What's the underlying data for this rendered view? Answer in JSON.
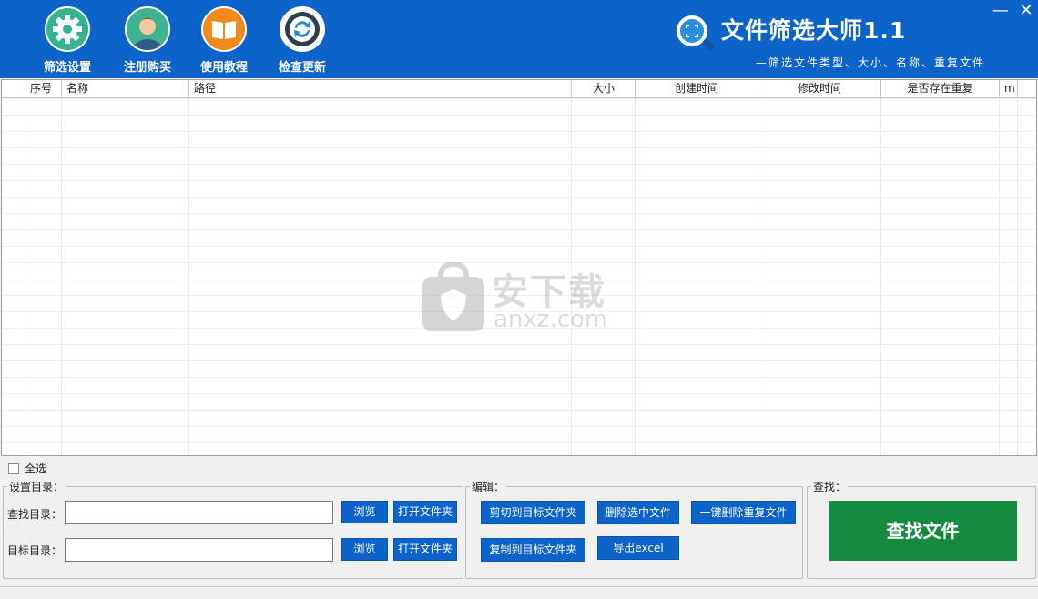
{
  "toolbar": {
    "items": [
      {
        "label": "筛选设置"
      },
      {
        "label": "注册购买"
      },
      {
        "label": "使用教程"
      },
      {
        "label": "检查更新"
      }
    ]
  },
  "brand": {
    "title": "文件筛选大师1.1",
    "subtitle": "—筛选文件类型、大小、名称、重复文件"
  },
  "window": {
    "minimize": "—",
    "close": "✕"
  },
  "table": {
    "columns": [
      "",
      "序号",
      "名称",
      "路径",
      "大小",
      "创建时间",
      "修改时间",
      "是否存在重复",
      "m"
    ]
  },
  "watermark": {
    "big": "安下载",
    "small": "anxz.com"
  },
  "select_all": {
    "label": "全选"
  },
  "settings": {
    "legend": "设置目录：",
    "search_dir_label": "查找目录：",
    "target_dir_label": "目标目录：",
    "search_dir_value": "",
    "target_dir_value": "",
    "browse1": "浏览",
    "open1": "打开文件夹",
    "browse2": "浏览",
    "open2": "打开文件夹"
  },
  "edit": {
    "legend": "编辑：",
    "cut": "剪切到目标文件夹",
    "delete_selected": "删除选中文件",
    "delete_dup": "一键删除重复文件",
    "copy": "复制到目标文件夹",
    "export": "导出excel"
  },
  "find": {
    "legend": "查找：",
    "button": "查找文件"
  },
  "colors": {
    "header": "#0c63c9",
    "button": "#0c63c9",
    "find_button": "#168a3e"
  }
}
